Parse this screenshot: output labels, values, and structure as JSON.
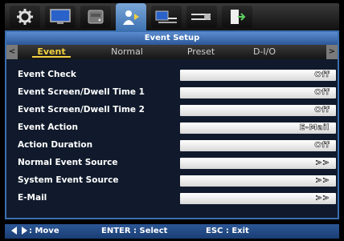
{
  "icon_bar": {
    "tabs": [
      {
        "icon": "gear-icon",
        "active": false
      },
      {
        "icon": "display-icon",
        "active": false
      },
      {
        "icon": "hdd-icon",
        "active": false
      },
      {
        "icon": "event-person-icon",
        "active": true
      },
      {
        "icon": "network-icon",
        "active": false
      },
      {
        "icon": "device-sliders-icon",
        "active": false
      },
      {
        "icon": "exit-icon",
        "active": false
      }
    ]
  },
  "window": {
    "title": "Event Setup"
  },
  "tabs": [
    {
      "label": "Event",
      "active": true
    },
    {
      "label": "Normal",
      "active": false
    },
    {
      "label": "Preset",
      "active": false
    },
    {
      "label": "D-I/O",
      "active": false
    }
  ],
  "nav": {
    "left_arrow": "<",
    "right_arrow": ">"
  },
  "settings": [
    {
      "label": "Event Check",
      "value": "Off"
    },
    {
      "label": "Event Screen/Dwell Time 1",
      "value": "Off"
    },
    {
      "label": "Event Screen/Dwell Time 2",
      "value": "Off"
    },
    {
      "label": "Event Action",
      "value": "E-Mail"
    },
    {
      "label": "Action Duration",
      "value": "Off"
    },
    {
      "label": "Normal Event Source",
      "value": ">>"
    },
    {
      "label": "System Event Source",
      "value": ">>"
    },
    {
      "label": "E-Mail",
      "value": ">>"
    }
  ],
  "footer": {
    "move": ": Move",
    "select": "ENTER : Select",
    "exit": "ESC : Exit"
  },
  "colors": {
    "accent": "#3b6fb0",
    "active_tab": "#f3d040",
    "panel_bg": "#101a2c"
  }
}
